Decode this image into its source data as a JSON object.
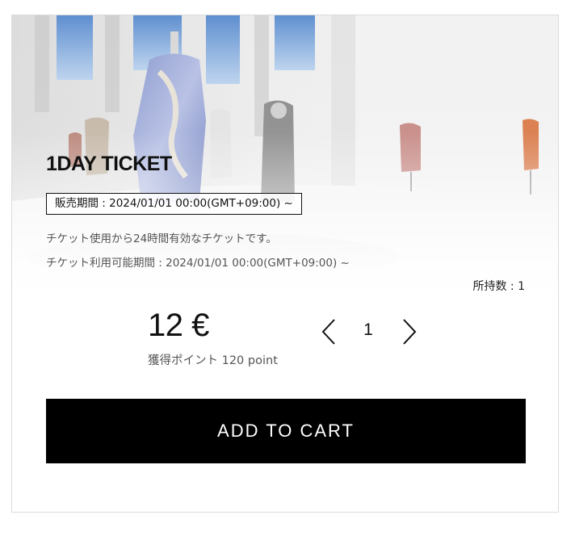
{
  "ticket": {
    "title": "1DAY TICKET",
    "sale_period": "販売期間 : 2024/01/01 00:00(GMT+09:00) ~",
    "description": "チケット使用から24時間有効なチケットです。",
    "usage_period": "チケット利用可能期間 : 2024/01/01 00:00(GMT+09:00) ~",
    "owned": "所持数 : 1",
    "price": "12 €",
    "points": "獲得ポイント 120 point"
  },
  "quantity": {
    "value": "1",
    "decrement_icon": "chevron-left-icon",
    "increment_icon": "chevron-right-icon"
  },
  "cart_button": {
    "label": "ADD TO CART",
    "background": "#000000",
    "text_color": "#ffffff"
  },
  "hero_image": {
    "subject": "virtual fashion gallery with dress mannequins"
  }
}
